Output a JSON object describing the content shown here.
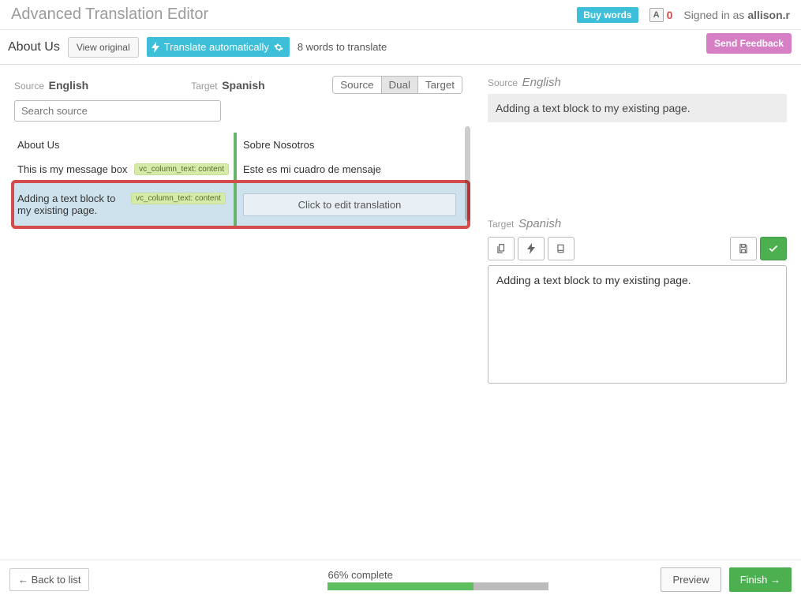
{
  "header": {
    "title": "Advanced Translation Editor",
    "buy_words": "Buy words",
    "word_count": "0",
    "signed_in_prefix": "Signed in as ",
    "user": "allison.r"
  },
  "subheader": {
    "page_name": "About Us",
    "view_original": "View original",
    "translate_auto": "Translate automatically",
    "words_to_translate": "8 words to translate",
    "send_feedback": "Send Feedback"
  },
  "left": {
    "source_label": "Source",
    "source_lang": "English",
    "target_label": "Target",
    "target_lang": "Spanish",
    "search_placeholder": "Search source",
    "view_toggle": {
      "source": "Source",
      "dual": "Dual",
      "target": "Target"
    },
    "rows": [
      {
        "src": "About Us",
        "tgt": "Sobre Nosotros",
        "tagged": false
      },
      {
        "src": "This is my message box",
        "tgt": "Este es mi cuadro de mensaje",
        "tagged": true,
        "tag": "vc_column_text: content"
      },
      {
        "src": "Adding a text block to my existing page.",
        "tgt_placeholder": "Click to edit translation",
        "tagged": true,
        "tag": "vc_column_text: content"
      }
    ]
  },
  "right": {
    "source_label": "Source",
    "source_lang": "English",
    "source_text": "Adding a text block to my existing page.",
    "target_label": "Target",
    "target_lang": "Spanish",
    "editor_value": "Adding a text block to my existing page."
  },
  "footer": {
    "back": "← Back to list",
    "progress_label": "66% complete",
    "progress_pct": 66,
    "preview": "Preview",
    "finish": "Finish →"
  }
}
